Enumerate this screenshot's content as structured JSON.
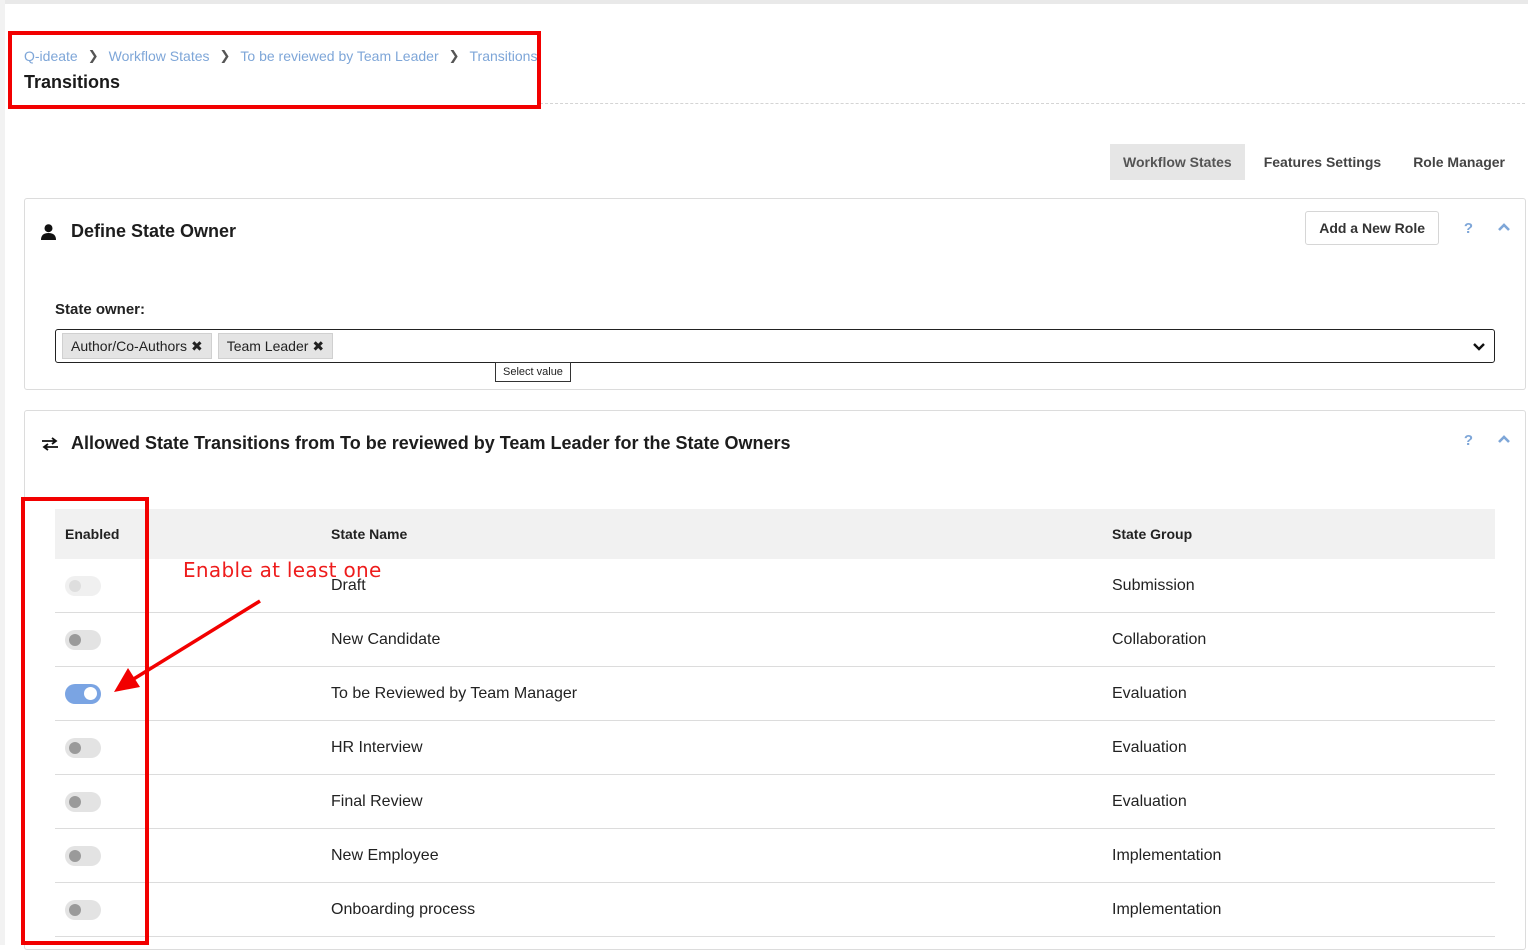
{
  "breadcrumb": {
    "items": [
      "Q-ideate",
      "Workflow States",
      "To be reviewed by Team Leader",
      "Transitions"
    ],
    "title": "Transitions"
  },
  "tabs": [
    {
      "label": "Workflow States",
      "active": true
    },
    {
      "label": "Features Settings",
      "active": false
    },
    {
      "label": "Role Manager",
      "active": false
    }
  ],
  "owner_card": {
    "title": "Define State Owner",
    "add_role_label": "Add a New Role",
    "help": "?",
    "field_label": "State owner:",
    "selected": [
      "Author/Co-Authors",
      "Team Leader"
    ],
    "tooltip": "Select value"
  },
  "transitions_card": {
    "title": "Allowed State Transitions from To be reviewed by Team Leader for the State Owners",
    "help": "?",
    "columns": [
      "Enabled",
      "State Name",
      "State Group"
    ],
    "rows": [
      {
        "name": "Draft",
        "group": "Submission",
        "enabled": false,
        "disabled": true
      },
      {
        "name": "New Candidate",
        "group": "Collaboration",
        "enabled": false,
        "disabled": false
      },
      {
        "name": "To be Reviewed by Team Manager",
        "group": "Evaluation",
        "enabled": true,
        "disabled": false
      },
      {
        "name": "HR Interview",
        "group": "Evaluation",
        "enabled": false,
        "disabled": false
      },
      {
        "name": "Final Review",
        "group": "Evaluation",
        "enabled": false,
        "disabled": false
      },
      {
        "name": "New Employee",
        "group": "Implementation",
        "enabled": false,
        "disabled": false
      },
      {
        "name": "Onboarding process",
        "group": "Implementation",
        "enabled": false,
        "disabled": false
      }
    ]
  },
  "annotation": {
    "text": "Enable at least one",
    "color": "#f20000"
  },
  "colors": {
    "link": "#7ea6d8",
    "toggle_on": "#7aa4e3"
  }
}
